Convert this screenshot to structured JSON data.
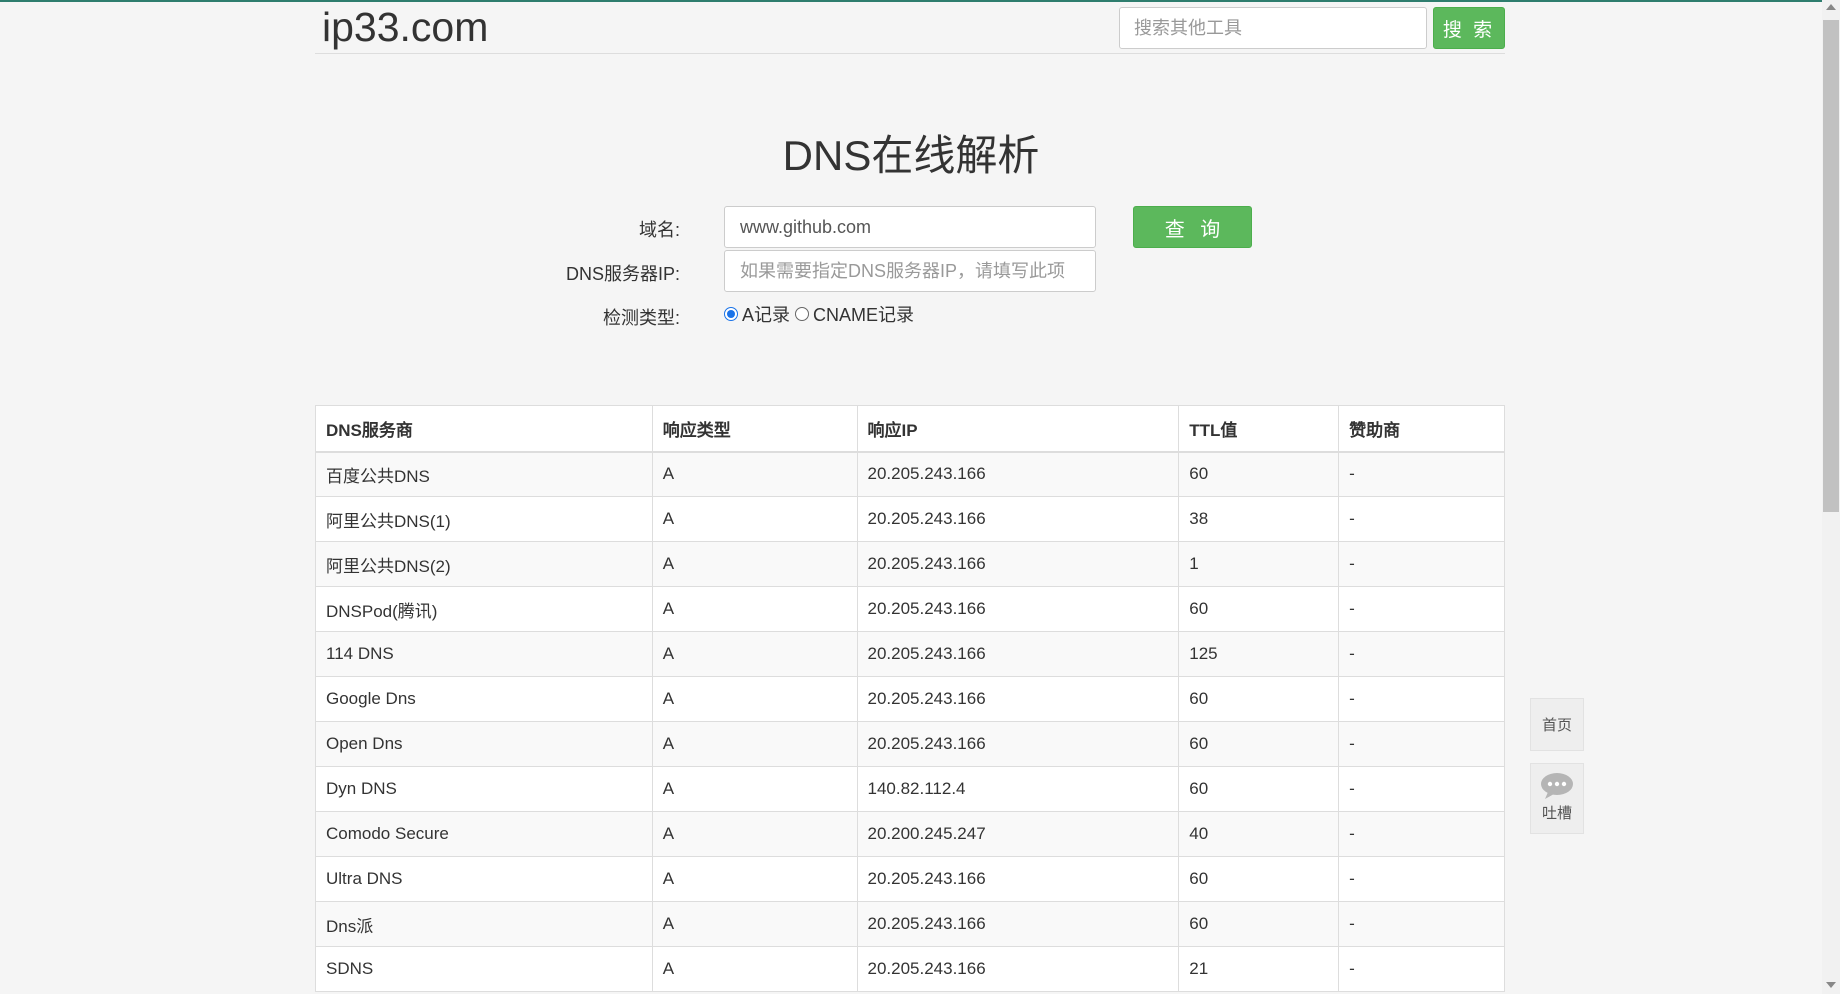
{
  "header": {
    "logo": "ip33.com",
    "search_placeholder": "搜索其他工具",
    "search_button": "搜 索"
  },
  "title": "DNS在线解析",
  "form": {
    "domain_label": "域名:",
    "domain_value": "www.github.com",
    "dns_ip_label": "DNS服务器IP:",
    "dns_ip_placeholder": "如果需要指定DNS服务器IP，请填写此项",
    "type_label": "检测类型:",
    "type_a": "A记录",
    "type_cname": "CNAME记录",
    "selected_type": "A记录",
    "query_button": "查 询"
  },
  "table": {
    "headers": [
      "DNS服务商",
      "响应类型",
      "响应IP",
      "TTL值",
      "赞助商"
    ],
    "rows": [
      [
        "百度公共DNS",
        "A",
        "20.205.243.166",
        "60",
        "-"
      ],
      [
        "阿里公共DNS(1)",
        "A",
        "20.205.243.166",
        "38",
        "-"
      ],
      [
        "阿里公共DNS(2)",
        "A",
        "20.205.243.166",
        "1",
        "-"
      ],
      [
        "DNSPod(腾讯)",
        "A",
        "20.205.243.166",
        "60",
        "-"
      ],
      [
        "114 DNS",
        "A",
        "20.205.243.166",
        "125",
        "-"
      ],
      [
        "Google Dns",
        "A",
        "20.205.243.166",
        "60",
        "-"
      ],
      [
        "Open Dns",
        "A",
        "20.205.243.166",
        "60",
        "-"
      ],
      [
        "Dyn DNS",
        "A",
        "140.82.112.4",
        "60",
        "-"
      ],
      [
        "Comodo Secure",
        "A",
        "20.200.245.247",
        "40",
        "-"
      ],
      [
        "Ultra DNS",
        "A",
        "20.205.243.166",
        "60",
        "-"
      ],
      [
        "Dns派",
        "A",
        "20.205.243.166",
        "60",
        "-"
      ],
      [
        "SDNS",
        "A",
        "20.205.243.166",
        "21",
        "-"
      ]
    ]
  },
  "side": {
    "home": "首页",
    "feedback": "吐槽"
  },
  "colors": {
    "accent_green": "#5cb85c",
    "top_bar": "#2e7d6e",
    "radio_blue": "#1a73e8"
  }
}
